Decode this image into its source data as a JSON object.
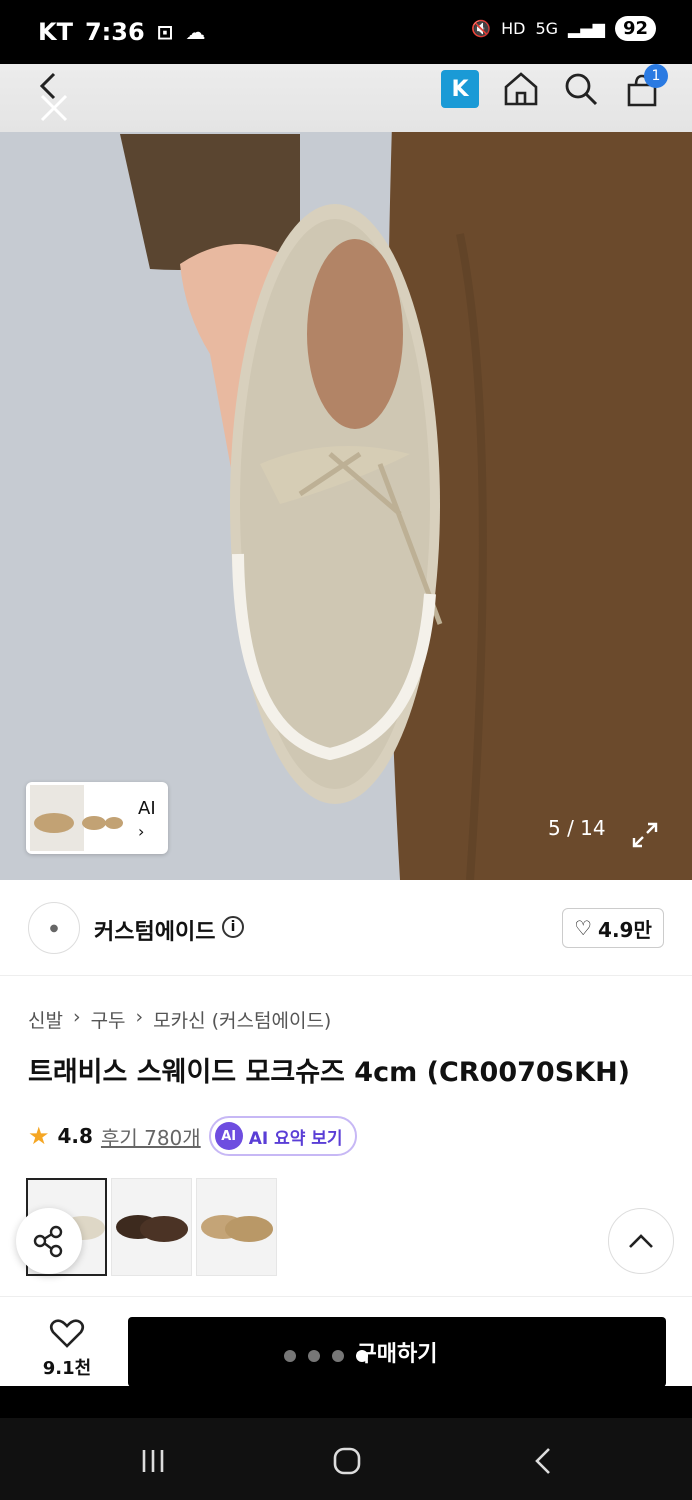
{
  "status_bar": {
    "carrier": "KT",
    "time": "7:36",
    "battery": "92"
  },
  "header": {
    "k_label": "K",
    "cart_count": "1"
  },
  "gallery": {
    "counter": "5 / 14",
    "ai_label": "AI"
  },
  "brand": {
    "name": "커스텀에이드",
    "likes": "4.9만"
  },
  "breadcrumb": [
    "신발",
    "구두",
    "모카신 (커스텀에이드)"
  ],
  "product": {
    "title": "트래비스 스웨이드 모크슈즈 4cm (CR0070SKH)",
    "rating": "4.8",
    "reviews": "후기 780개",
    "ai_summary": "AI 요약 보기"
  },
  "bottom": {
    "wish_count": "9.1천",
    "buy_label": "구매하기"
  },
  "colors": {
    "accent": "#1a9ad6",
    "ai": "#6e4de0",
    "pants": "#6b4a2c",
    "shoe": "#d8d0bd"
  }
}
